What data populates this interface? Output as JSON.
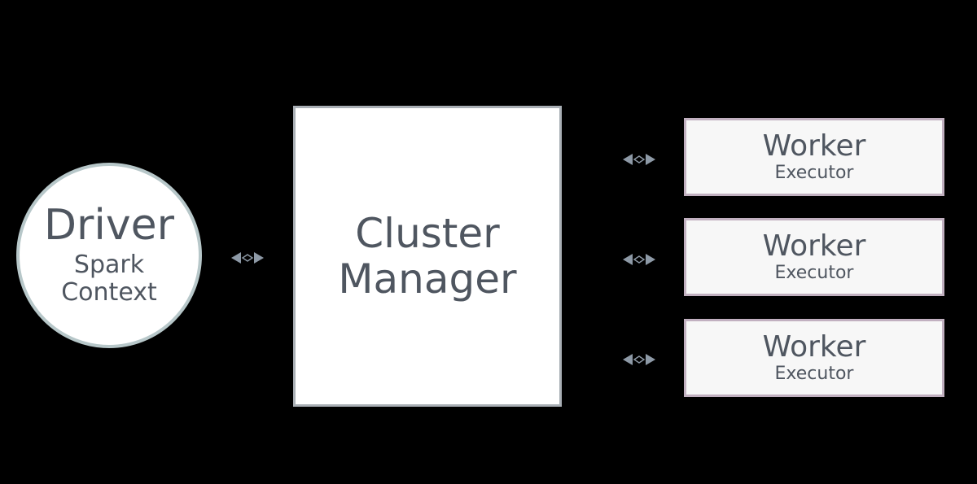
{
  "driver": {
    "title": "Driver",
    "sub1": "Spark",
    "sub2": "Context"
  },
  "cluster": {
    "line1": "Cluster",
    "line2": "Manager"
  },
  "workers": [
    {
      "title": "Worker",
      "sub": "Executor"
    },
    {
      "title": "Worker",
      "sub": "Executor"
    },
    {
      "title": "Worker",
      "sub": "Executor"
    }
  ]
}
